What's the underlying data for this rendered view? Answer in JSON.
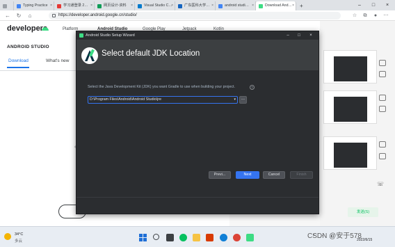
{
  "browser": {
    "tabs": [
      {
        "label": "",
        "color": "#9aa0a6"
      },
      {
        "label": "Typing Practice",
        "color": "#4285f4"
      },
      {
        "label": "学习通登录 2…",
        "color": "#e53935"
      },
      {
        "label": "网页设计-资料",
        "color": "#0f9d58"
      },
      {
        "label": "Visual Studio C…",
        "color": "#007acc"
      },
      {
        "label": "广东医科大学…",
        "color": "#1565c0"
      },
      {
        "label": "android studi…",
        "color": "#4285f4"
      },
      {
        "label": "Download And…",
        "color": "#3ddc84"
      }
    ],
    "new_tab": "+",
    "url": "https://developer.android.google.cn/studio/"
  },
  "site": {
    "logo": "developers",
    "top_nav": [
      "Platform",
      "Android Studio",
      "Google Play",
      "Jetpack",
      "Kotlin"
    ],
    "section_title": "ANDROID STUDIO",
    "sub_nav": [
      "Download",
      "What's new"
    ]
  },
  "chat": {
    "send_button": "发送(S)"
  },
  "dialog": {
    "window_title": "Android Studio Setup Wizard",
    "heading": "Select default JDK Location",
    "description": "Select the Java Development Kit (JDK) you want Gradle to use when building your project.",
    "help": "?",
    "jdk_path": "D:\\Program Files\\Android\\Android Studio\\jre",
    "browse": "...",
    "buttons": {
      "prev": "Previ...",
      "next": "Next",
      "cancel": "Cancel",
      "finish": "Finish"
    }
  },
  "taskbar": {
    "weather_temp": "34°C",
    "weather_desc": "多云",
    "time": "",
    "date": "2022/6/15"
  },
  "watermark": "CSDN @安于578"
}
